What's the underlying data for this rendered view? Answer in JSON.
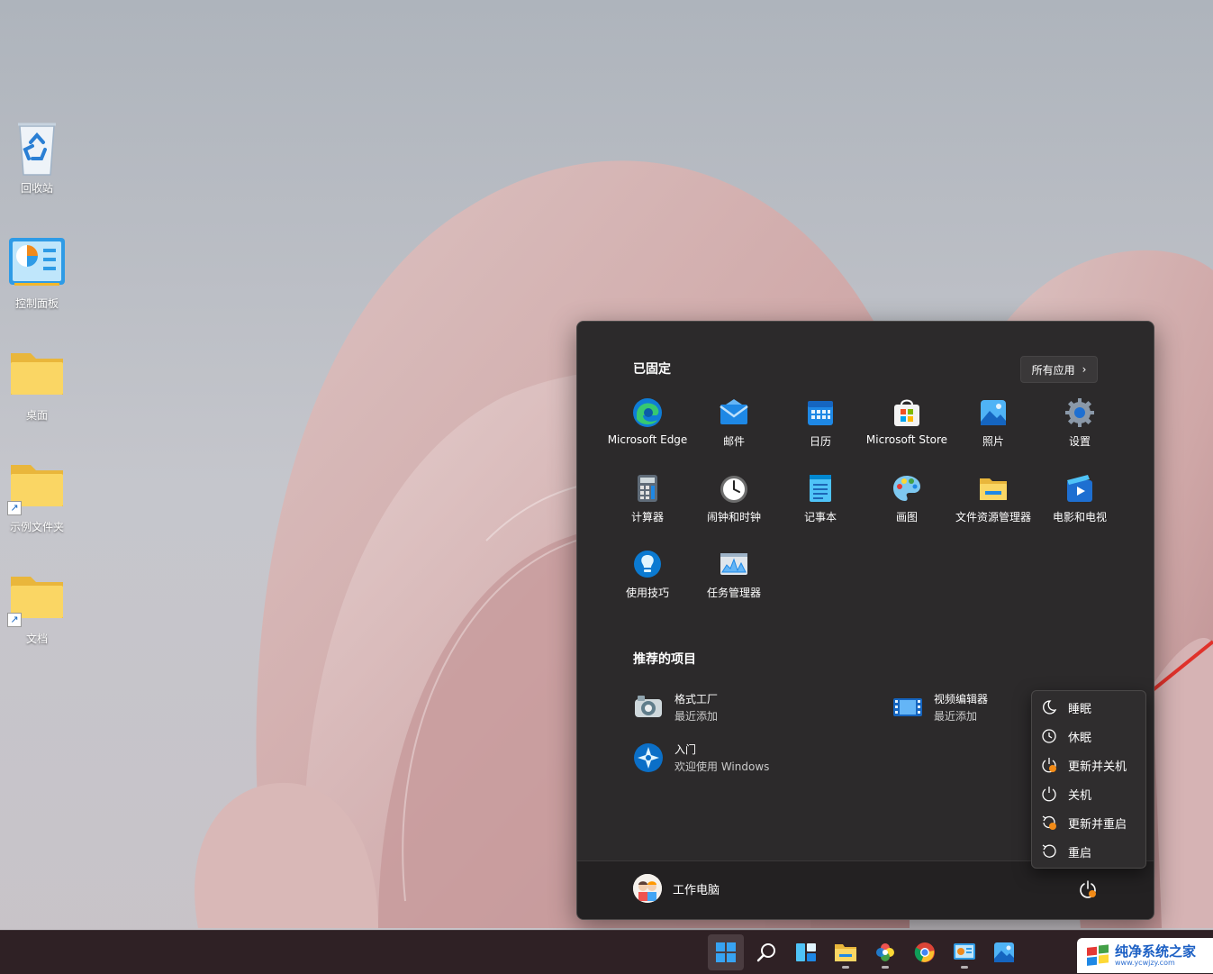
{
  "desktop": {
    "icons": [
      {
        "label": "回收站",
        "icon": "recycle-bin-icon"
      },
      {
        "label": "控制面板",
        "icon": "control-panel-icon"
      },
      {
        "label": "桌面",
        "icon": "folder-icon"
      },
      {
        "label": "示例文件夹",
        "icon": "folder-icon"
      },
      {
        "label": "文档",
        "icon": "folder-icon"
      }
    ]
  },
  "start_menu": {
    "pinned_title": "已固定",
    "all_apps_label": "所有应用",
    "all_apps_chevron": "›",
    "pinned": [
      {
        "label": "Microsoft Edge",
        "icon": "edge-icon"
      },
      {
        "label": "邮件",
        "icon": "mail-icon"
      },
      {
        "label": "日历",
        "icon": "calendar-icon"
      },
      {
        "label": "Microsoft Store",
        "icon": "store-icon"
      },
      {
        "label": "照片",
        "icon": "photos-icon"
      },
      {
        "label": "设置",
        "icon": "settings-icon"
      },
      {
        "label": "计算器",
        "icon": "calculator-icon"
      },
      {
        "label": "闹钟和时钟",
        "icon": "clock-icon"
      },
      {
        "label": "记事本",
        "icon": "notepad-icon"
      },
      {
        "label": "画图",
        "icon": "paint-icon"
      },
      {
        "label": "文件资源管理器",
        "icon": "file-explorer-icon"
      },
      {
        "label": "电影和电视",
        "icon": "movies-tv-icon"
      },
      {
        "label": "使用技巧",
        "icon": "tips-icon"
      },
      {
        "label": "任务管理器",
        "icon": "task-manager-icon"
      }
    ],
    "recommended_title": "推荐的项目",
    "recommended": [
      {
        "name": "格式工厂",
        "sub": "最近添加",
        "icon": "format-factory-icon"
      },
      {
        "name": "视频编辑器",
        "sub": "最近添加",
        "icon": "video-editor-icon"
      },
      {
        "name": "入门",
        "sub": "欢迎使用 Windows",
        "icon": "get-started-icon"
      }
    ],
    "user_name": "工作电脑"
  },
  "power_menu": {
    "items": [
      {
        "label": "睡眠",
        "icon": "sleep-icon"
      },
      {
        "label": "休眠",
        "icon": "hibernate-icon"
      },
      {
        "label": "更新并关机",
        "icon": "update-shutdown-icon"
      },
      {
        "label": "关机",
        "icon": "power-icon"
      },
      {
        "label": "更新并重启",
        "icon": "update-restart-icon"
      },
      {
        "label": "重启",
        "icon": "restart-icon"
      }
    ]
  },
  "taskbar": {
    "icons": [
      "start-icon",
      "search-icon",
      "widgets-icon",
      "file-explorer-icon",
      "photos-app-icon",
      "chrome-icon",
      "control-panel-icon",
      "photos-icon"
    ]
  },
  "watermark": {
    "title": "纯净系统之家",
    "url": "www.ycwjzy.com"
  },
  "colors": {
    "menu_bg": "#2c2a2b",
    "taskbar_bg": "#2f2125",
    "accent": "#0a84d6",
    "arrow": "#e0322b"
  }
}
